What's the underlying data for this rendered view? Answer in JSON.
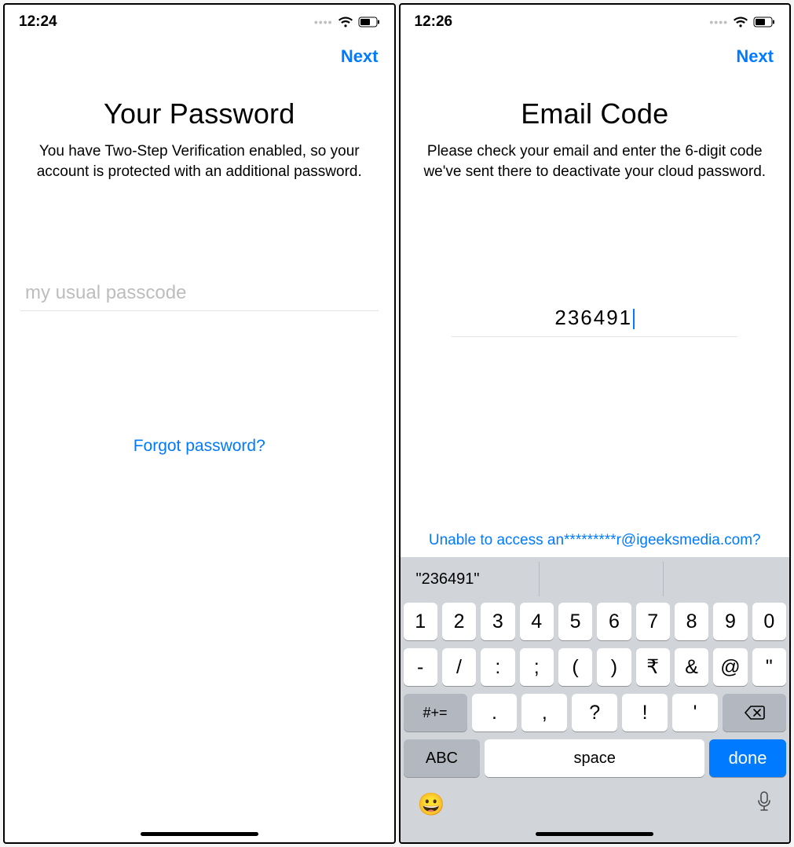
{
  "left": {
    "status": {
      "time": "12:24"
    },
    "nav": {
      "next": "Next"
    },
    "title": "Your Password",
    "subtitle": "You have Two-Step Verification enabled, so your account is protected with an additional password.",
    "input": {
      "placeholder": "my usual passcode",
      "value": ""
    },
    "forgot": "Forgot password?"
  },
  "right": {
    "status": {
      "time": "12:26"
    },
    "nav": {
      "next": "Next"
    },
    "title": "Email Code",
    "subtitle": "Please check your email and enter the 6-digit code we've sent there to deactivate your cloud password.",
    "code": "236491",
    "unable": "Unable to access an*********r@igeeksmedia.com?",
    "keyboard": {
      "suggestion": "\"236491\"",
      "row1": [
        "1",
        "2",
        "3",
        "4",
        "5",
        "6",
        "7",
        "8",
        "9",
        "0"
      ],
      "row2": [
        "-",
        "/",
        ":",
        ";",
        "(",
        ")",
        "₹",
        "&",
        "@",
        "\""
      ],
      "row3": {
        "shift": "#+=",
        "keys": [
          ".",
          ",",
          "?",
          "!",
          "'"
        ]
      },
      "row4": {
        "abc": "ABC",
        "space": "space",
        "done": "done"
      }
    }
  }
}
